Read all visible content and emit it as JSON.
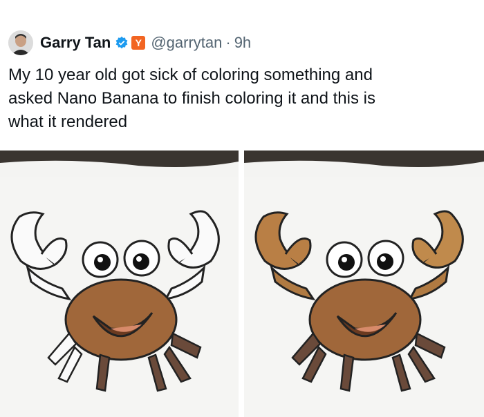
{
  "post": {
    "author_name": "Garry Tan",
    "badge_letter": "Y",
    "handle": "@garrytan",
    "separator": "·",
    "time": "9h",
    "text": "My 10 year old got sick of coloring something and\nasked Nano Banana to finish coloring it and this is\nwhat it rendered"
  },
  "images": [
    {
      "name": "original-partially-colored-crab"
    },
    {
      "name": "ai-finished-colored-crab"
    }
  ],
  "colors": {
    "verified_blue": "#1d9bf0",
    "yc_orange": "#f26522",
    "handle_gray": "#536471",
    "crab_body": "#a0673a",
    "crab_claw": "#b97f45"
  }
}
